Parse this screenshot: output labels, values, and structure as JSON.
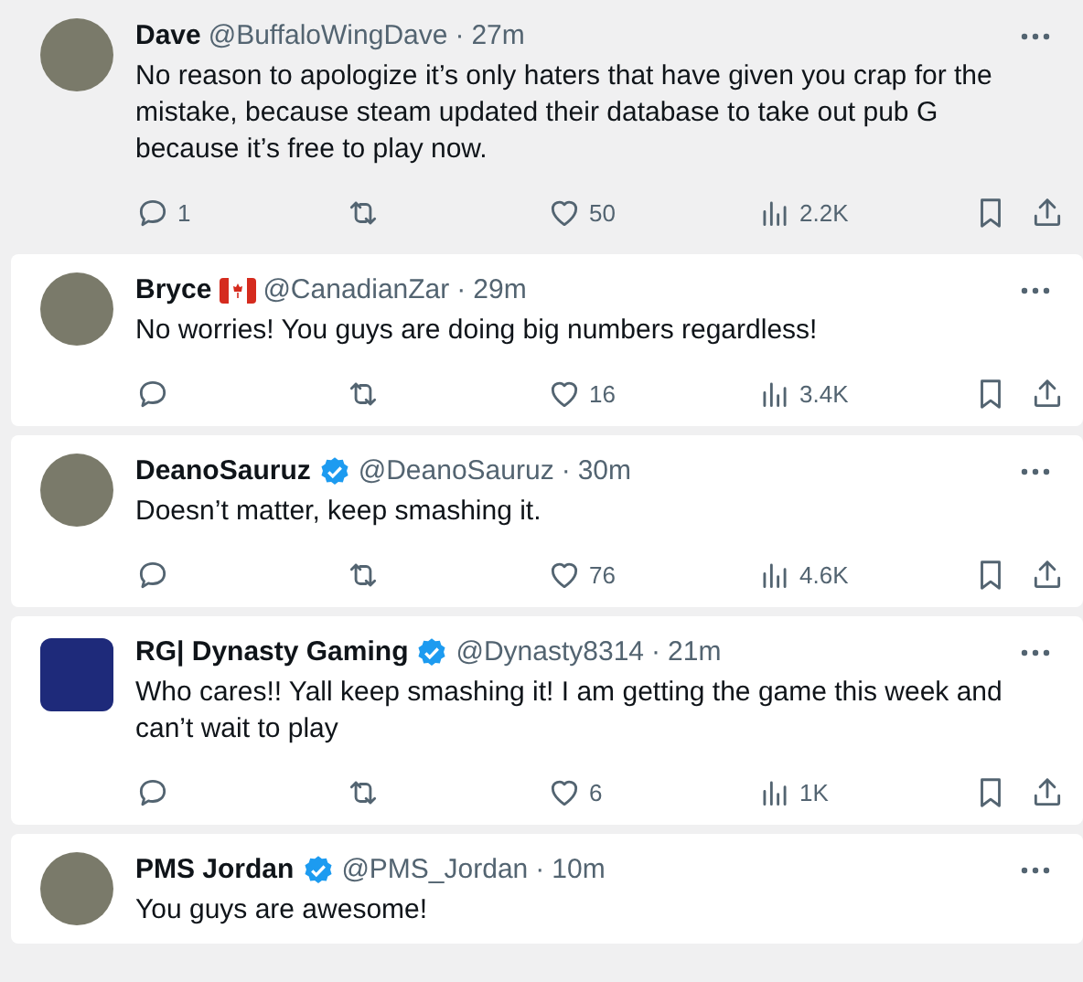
{
  "replies": [
    {
      "kind": "photo",
      "name": "Dave",
      "verified": false,
      "country_flag": false,
      "handle": "@BuffaloWingDave",
      "separator": "·",
      "time": "27m",
      "highlighted": true,
      "text": "No reason to apologize it’s only haters that have given you crap for the mistake, because steam updated their database to take out pub G because it’s free to play now.",
      "replies": "1",
      "likes": "50",
      "views": "2.2K"
    },
    {
      "kind": "photo",
      "name": "Bryce",
      "verified": false,
      "country_flag": true,
      "handle": "@CanadianZar",
      "separator": "·",
      "time": "29m",
      "highlighted": false,
      "text": "No worries! You guys are doing big numbers regardless!",
      "likes": "16",
      "views": "3.4K"
    },
    {
      "kind": "photo",
      "name": "DeanoSauruz",
      "verified": true,
      "country_flag": false,
      "handle": "@DeanoSauruz",
      "separator": "·",
      "time": "30m",
      "highlighted": false,
      "text": "Doesn’t matter, keep smashing it.",
      "likes": "76",
      "views": "4.6K"
    },
    {
      "kind": "logo",
      "name": "RG| Dynasty Gaming",
      "verified": true,
      "country_flag": false,
      "handle": "@Dynasty8314",
      "separator": "·",
      "time": "21m",
      "highlighted": false,
      "text": "Who cares!! Yall keep smashing it!  I am getting the game this week and can’t wait to play",
      "likes": "6",
      "views": "1K"
    },
    {
      "kind": "photo",
      "name": "PMS Jordan",
      "verified": true,
      "country_flag": false,
      "handle": "@PMS_Jordan",
      "separator": "·",
      "time": "10m",
      "highlighted": false,
      "text": "You guys are awesome!"
    }
  ]
}
